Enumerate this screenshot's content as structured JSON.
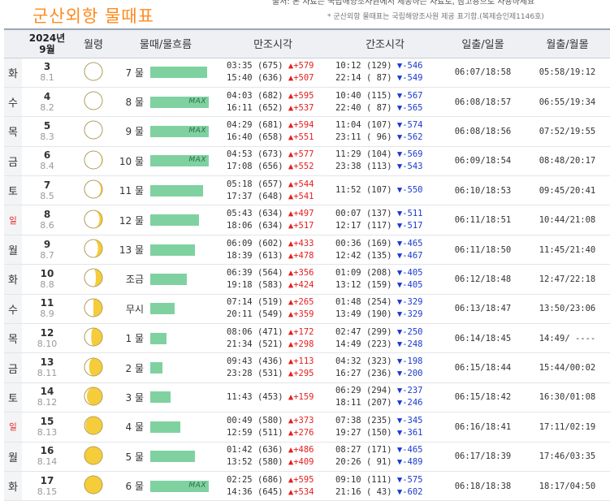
{
  "page": {
    "title": "군산외항  물때표",
    "header_strip": "출처: 본 자료는 국립해양조사원에서 제공하는 자료로, 참고용으로 사용하세요",
    "source_note": "* 군산외항 물때표는 국립해양조사원 제공 표기함.(복제승인제1146호)"
  },
  "table": {
    "headers": {
      "date_year": "2024년",
      "date_month": "9월",
      "moon": "월령",
      "tide": "물때/물흐름",
      "high": "만조시각",
      "low": "간조시각",
      "sun": "일출/일몰",
      "moontime": "월출/월몰"
    },
    "max_label": "MAX",
    "rows": [
      {
        "weekday": "화",
        "sunday": false,
        "day": "3",
        "lunar": "8.1",
        "moon_phase": 0.01,
        "tide_name": "7 물",
        "flow_level": 70,
        "max": false,
        "high": [
          {
            "time": "03:35",
            "level": "(675)",
            "change": "▲+579"
          },
          {
            "time": "15:40",
            "level": "(636)",
            "change": "▲+507"
          }
        ],
        "low": [
          {
            "time": "10:12",
            "level": "(129)",
            "change": "▼-546"
          },
          {
            "time": "22:14",
            "level": "( 87)",
            "change": "▼-549"
          }
        ],
        "sun": "06:07/18:58",
        "moontime": "05:58/19:12"
      },
      {
        "weekday": "수",
        "sunday": false,
        "day": "4",
        "lunar": "8.2",
        "moon_phase": 0.04,
        "tide_name": "8 물",
        "flow_level": 72,
        "max": true,
        "high": [
          {
            "time": "04:03",
            "level": "(682)",
            "change": "▲+595"
          },
          {
            "time": "16:11",
            "level": "(652)",
            "change": "▲+537"
          }
        ],
        "low": [
          {
            "time": "10:40",
            "level": "(115)",
            "change": "▼-567"
          },
          {
            "time": "22:40",
            "level": "( 87)",
            "change": "▼-565"
          }
        ],
        "sun": "06:08/18:57",
        "moontime": "06:55/19:34"
      },
      {
        "weekday": "목",
        "sunday": false,
        "day": "5",
        "lunar": "8.3",
        "moon_phase": 0.08,
        "tide_name": "9 물",
        "flow_level": 72,
        "max": true,
        "high": [
          {
            "time": "04:29",
            "level": "(681)",
            "change": "▲+594"
          },
          {
            "time": "16:40",
            "level": "(658)",
            "change": "▲+551"
          }
        ],
        "low": [
          {
            "time": "11:04",
            "level": "(107)",
            "change": "▼-574"
          },
          {
            "time": "23:11",
            "level": "( 96)",
            "change": "▼-562"
          }
        ],
        "sun": "06:08/18:56",
        "moontime": "07:52/19:55"
      },
      {
        "weekday": "금",
        "sunday": false,
        "day": "6",
        "lunar": "8.4",
        "moon_phase": 0.13,
        "tide_name": "10 물",
        "flow_level": 72,
        "max": true,
        "high": [
          {
            "time": "04:53",
            "level": "(673)",
            "change": "▲+577"
          },
          {
            "time": "17:08",
            "level": "(656)",
            "change": "▲+552"
          }
        ],
        "low": [
          {
            "time": "11:29",
            "level": "(104)",
            "change": "▼-569"
          },
          {
            "time": "23:38",
            "level": "(113)",
            "change": "▼-543"
          }
        ],
        "sun": "06:09/18:54",
        "moontime": "08:48/20:17"
      },
      {
        "weekday": "토",
        "sunday": false,
        "day": "7",
        "lunar": "8.5",
        "moon_phase": 0.19,
        "tide_name": "11 물",
        "flow_level": 65,
        "max": false,
        "high": [
          {
            "time": "05:18",
            "level": "(657)",
            "change": "▲+544"
          },
          {
            "time": "17:37",
            "level": "(648)",
            "change": "▲+541"
          }
        ],
        "low": [
          {
            "time": "11:52",
            "level": "(107)",
            "change": "▼-550"
          }
        ],
        "sun": "06:10/18:53",
        "moontime": "09:45/20:41"
      },
      {
        "weekday": "일",
        "sunday": true,
        "day": "8",
        "lunar": "8.6",
        "moon_phase": 0.26,
        "tide_name": "12 물",
        "flow_level": 60,
        "max": false,
        "high": [
          {
            "time": "05:43",
            "level": "(634)",
            "change": "▲+497"
          },
          {
            "time": "18:06",
            "level": "(634)",
            "change": "▲+517"
          }
        ],
        "low": [
          {
            "time": "00:07",
            "level": "(137)",
            "change": "▼-511"
          },
          {
            "time": "12:17",
            "level": "(117)",
            "change": "▼-517"
          }
        ],
        "sun": "06:11/18:51",
        "moontime": "10:44/21:08"
      },
      {
        "weekday": "월",
        "sunday": false,
        "day": "9",
        "lunar": "8.7",
        "moon_phase": 0.33,
        "tide_name": "13 물",
        "flow_level": 55,
        "max": false,
        "high": [
          {
            "time": "06:09",
            "level": "(602)",
            "change": "▲+433"
          },
          {
            "time": "18:39",
            "level": "(613)",
            "change": "▲+478"
          }
        ],
        "low": [
          {
            "time": "00:36",
            "level": "(169)",
            "change": "▼-465"
          },
          {
            "time": "12:42",
            "level": "(135)",
            "change": "▼-467"
          }
        ],
        "sun": "06:11/18:50",
        "moontime": "11:45/21:40"
      },
      {
        "weekday": "화",
        "sunday": false,
        "day": "10",
        "lunar": "8.8",
        "moon_phase": 0.41,
        "tide_name": "조금",
        "flow_level": 45,
        "max": false,
        "high": [
          {
            "time": "06:39",
            "level": "(564)",
            "change": "▲+356"
          },
          {
            "time": "19:18",
            "level": "(583)",
            "change": "▲+424"
          }
        ],
        "low": [
          {
            "time": "01:09",
            "level": "(208)",
            "change": "▼-405"
          },
          {
            "time": "13:12",
            "level": "(159)",
            "change": "▼-405"
          }
        ],
        "sun": "06:12/18:48",
        "moontime": "12:47/22:18"
      },
      {
        "weekday": "수",
        "sunday": false,
        "day": "11",
        "lunar": "8.9",
        "moon_phase": 0.5,
        "tide_name": "무시",
        "flow_level": 30,
        "max": false,
        "high": [
          {
            "time": "07:14",
            "level": "(519)",
            "change": "▲+265"
          },
          {
            "time": "20:11",
            "level": "(549)",
            "change": "▲+359"
          }
        ],
        "low": [
          {
            "time": "01:48",
            "level": "(254)",
            "change": "▼-329"
          },
          {
            "time": "13:49",
            "level": "(190)",
            "change": "▼-329"
          }
        ],
        "sun": "06:13/18:47",
        "moontime": "13:50/23:06"
      },
      {
        "weekday": "목",
        "sunday": false,
        "day": "12",
        "lunar": "8.10",
        "moon_phase": 0.58,
        "tide_name": "1 물",
        "flow_level": 20,
        "max": false,
        "high": [
          {
            "time": "08:06",
            "level": "(471)",
            "change": "▲+172"
          },
          {
            "time": "21:34",
            "level": "(521)",
            "change": "▲+298"
          }
        ],
        "low": [
          {
            "time": "02:47",
            "level": "(299)",
            "change": "▼-250"
          },
          {
            "time": "14:49",
            "level": "(223)",
            "change": "▼-248"
          }
        ],
        "sun": "06:14/18:45",
        "moontime": "14:49/ ----"
      },
      {
        "weekday": "금",
        "sunday": false,
        "day": "13",
        "lunar": "8.11",
        "moon_phase": 0.66,
        "tide_name": "2 물",
        "flow_level": 15,
        "max": false,
        "high": [
          {
            "time": "09:43",
            "level": "(436)",
            "change": "▲+113"
          },
          {
            "time": "23:28",
            "level": "(531)",
            "change": "▲+295"
          }
        ],
        "low": [
          {
            "time": "04:32",
            "level": "(323)",
            "change": "▼-198"
          },
          {
            "time": "16:27",
            "level": "(236)",
            "change": "▼-200"
          }
        ],
        "sun": "06:15/18:44",
        "moontime": "15:44/00:02"
      },
      {
        "weekday": "토",
        "sunday": false,
        "day": "14",
        "lunar": "8.12",
        "moon_phase": 0.76,
        "tide_name": "3 물",
        "flow_level": 25,
        "max": false,
        "high": [
          {
            "time": "11:43",
            "level": "(453)",
            "change": "▲+159"
          }
        ],
        "low": [
          {
            "time": "06:29",
            "level": "(294)",
            "change": "▼-237"
          },
          {
            "time": "18:11",
            "level": "(207)",
            "change": "▼-246"
          }
        ],
        "sun": "06:15/18:42",
        "moontime": "16:30/01:08"
      },
      {
        "weekday": "일",
        "sunday": true,
        "day": "15",
        "lunar": "8.13",
        "moon_phase": 0.85,
        "tide_name": "4 물",
        "flow_level": 37,
        "max": false,
        "high": [
          {
            "time": "00:49",
            "level": "(580)",
            "change": "▲+373"
          },
          {
            "time": "12:59",
            "level": "(511)",
            "change": "▲+276"
          }
        ],
        "low": [
          {
            "time": "07:38",
            "level": "(235)",
            "change": "▼-345"
          },
          {
            "time": "19:27",
            "level": "(150)",
            "change": "▼-361"
          }
        ],
        "sun": "06:16/18:41",
        "moontime": "17:11/02:19"
      },
      {
        "weekday": "월",
        "sunday": false,
        "day": "16",
        "lunar": "8.14",
        "moon_phase": 0.93,
        "tide_name": "5 물",
        "flow_level": 55,
        "max": false,
        "high": [
          {
            "time": "01:42",
            "level": "(636)",
            "change": "▲+486"
          },
          {
            "time": "13:52",
            "level": "(580)",
            "change": "▲+409"
          }
        ],
        "low": [
          {
            "time": "08:27",
            "level": "(171)",
            "change": "▼-465"
          },
          {
            "time": "20:26",
            "level": "( 91)",
            "change": "▼-489"
          }
        ],
        "sun": "06:17/18:39",
        "moontime": "17:46/03:35"
      },
      {
        "weekday": "화",
        "sunday": false,
        "day": "17",
        "lunar": "8.15",
        "moon_phase": 1.0,
        "tide_name": "6 물",
        "flow_level": 72,
        "max": true,
        "high": [
          {
            "time": "02:25",
            "level": "(686)",
            "change": "▲+595"
          },
          {
            "time": "14:36",
            "level": "(645)",
            "change": "▲+534"
          }
        ],
        "low": [
          {
            "time": "09:10",
            "level": "(111)",
            "change": "▼-575"
          },
          {
            "time": "21:16",
            "level": "( 43)",
            "change": "▼-602"
          }
        ],
        "sun": "06:18/18:38",
        "moontime": "18:17/04:50"
      }
    ]
  },
  "colors": {
    "title": "#ff8a1c",
    "bar": "#7fd2a0",
    "moon_lit": "#f5cc3a",
    "moon_dark": "#ffffff",
    "rise": "#e41e1e",
    "fall": "#1a3ad0"
  },
  "icons": {
    "moon": "moon-phase-icon"
  }
}
